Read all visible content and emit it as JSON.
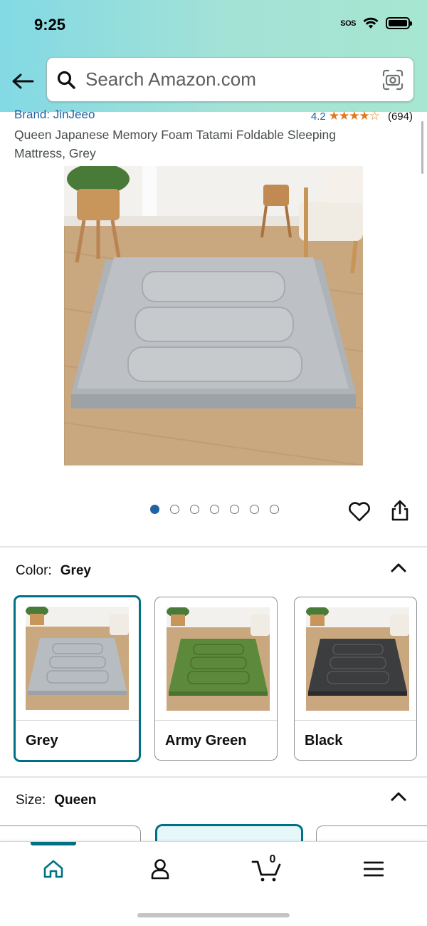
{
  "status_bar": {
    "time": "9:25",
    "sos": "SOS"
  },
  "search": {
    "placeholder": "Search Amazon.com"
  },
  "product": {
    "brand": "Brand: JinJeeo",
    "rating": "4.2",
    "rating_stars": "★★★★☆",
    "rating_count": "(694)",
    "title": "Queen Japanese Memory Foam Tatami Foldable Sleeping Mattress, Grey",
    "image_count": 7,
    "active_image": 1
  },
  "color_selector": {
    "label": "Color:",
    "selected": "Grey",
    "options": [
      {
        "label": "Grey",
        "mattress_color": "#b7bcc1"
      },
      {
        "label": "Army Green",
        "mattress_color": "#5c8a3a"
      },
      {
        "label": "Black",
        "mattress_color": "#3c3d3f"
      }
    ]
  },
  "size_selector": {
    "label": "Size:",
    "selected": "Queen"
  },
  "bottom_nav": {
    "items": [
      "home-icon",
      "account-icon",
      "cart-icon",
      "menu-icon"
    ],
    "cart_count": "0"
  },
  "colors": {
    "accent": "#007185",
    "link": "#2162a1",
    "star": "#de7921"
  }
}
